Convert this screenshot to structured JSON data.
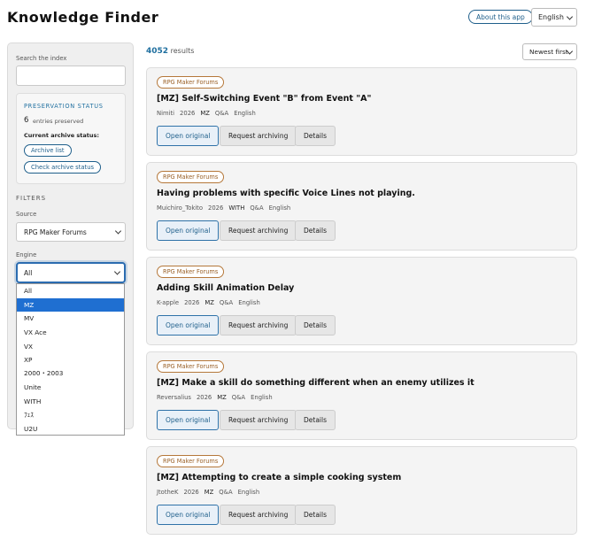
{
  "header": {
    "title": "Knowledge Finder",
    "about_label": "About this app",
    "language": "English"
  },
  "sidebar": {
    "search_label": "Search the index",
    "search_value": "",
    "preservation": {
      "title": "PRESERVATION STATUS",
      "count": "6",
      "count_label": "entries preserved",
      "current_label": "Current archive status:",
      "archive_list_label": "Archive list",
      "check_status_label": "Check archive status"
    },
    "filters_heading": "FILTERS",
    "source_label": "Source",
    "source_value": "RPG Maker Forums",
    "engine_label": "Engine",
    "engine_value": "All",
    "engine_options": [
      "All",
      "MZ",
      "MV",
      "VX Ace",
      "VX",
      "XP",
      "2000・2003",
      "Unite",
      "WITH",
      "ﾌｪｽ",
      "U2U"
    ],
    "engine_highlighted": "MZ"
  },
  "results": {
    "count": "4052",
    "count_label": "results",
    "sort_value": "Newest first"
  },
  "buttons": {
    "open": "Open original",
    "archive": "Request archiving",
    "details": "Details"
  },
  "cards": [
    {
      "source": "RPG Maker Forums",
      "title": "[MZ] Self-Switching Event \"B\" from Event \"A\"",
      "author": "Nimiti",
      "year": "2026",
      "engine": "MZ",
      "category": "Q&A",
      "language": "English"
    },
    {
      "source": "RPG Maker Forums",
      "title": "Having problems with specific Voice Lines not playing.",
      "author": "Muichiro_Tokito",
      "year": "2026",
      "engine": "WITH",
      "category": "Q&A",
      "language": "English"
    },
    {
      "source": "RPG Maker Forums",
      "title": "Adding Skill Animation Delay",
      "author": "K-apple",
      "year": "2026",
      "engine": "MZ",
      "category": "Q&A",
      "language": "English"
    },
    {
      "source": "RPG Maker Forums",
      "title": "[MZ] Make a skill do something different when an enemy utilizes it",
      "author": "Reversalius",
      "year": "2026",
      "engine": "MZ",
      "category": "Q&A",
      "language": "English"
    },
    {
      "source": "RPG Maker Forums",
      "title": "[MZ] Attempting to create a simple cooking system",
      "author": "JtotheK",
      "year": "2026",
      "engine": "MZ",
      "category": "Q&A",
      "language": "English"
    }
  ]
}
